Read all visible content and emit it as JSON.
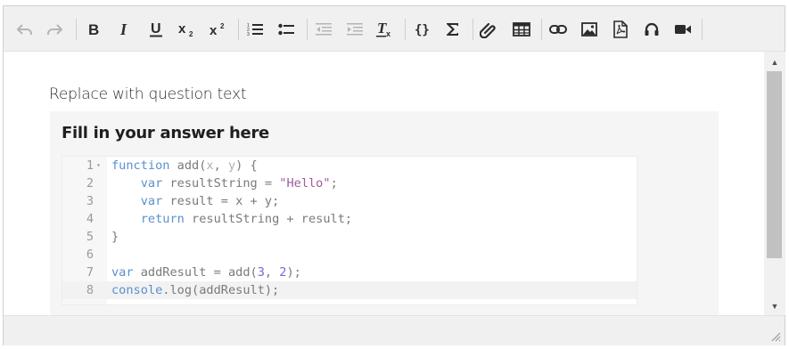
{
  "toolbar": {
    "buttons": [
      {
        "name": "undo-icon",
        "tooltip": "Undo",
        "enabled": false
      },
      {
        "name": "redo-icon",
        "tooltip": "Redo",
        "enabled": false
      },
      {
        "name": "bold-icon",
        "tooltip": "Bold",
        "enabled": true
      },
      {
        "name": "italic-icon",
        "tooltip": "Italic",
        "enabled": true
      },
      {
        "name": "underline-icon",
        "tooltip": "Underline",
        "enabled": true
      },
      {
        "name": "subscript-icon",
        "tooltip": "Subscript",
        "enabled": true
      },
      {
        "name": "superscript-icon",
        "tooltip": "Superscript",
        "enabled": true
      },
      {
        "name": "numbered-list-icon",
        "tooltip": "Numbered list",
        "enabled": true
      },
      {
        "name": "bulleted-list-icon",
        "tooltip": "Bulleted list",
        "enabled": true
      },
      {
        "name": "decrease-indent-icon",
        "tooltip": "Decrease indent",
        "enabled": false
      },
      {
        "name": "increase-indent-icon",
        "tooltip": "Increase indent",
        "enabled": false
      },
      {
        "name": "clear-formatting-icon",
        "tooltip": "Clear formatting",
        "enabled": true
      },
      {
        "name": "code-braces-icon",
        "tooltip": "Code",
        "enabled": true
      },
      {
        "name": "sigma-icon",
        "tooltip": "Math",
        "enabled": true
      },
      {
        "name": "paperclip-icon",
        "tooltip": "Attach file",
        "enabled": true
      },
      {
        "name": "table-icon",
        "tooltip": "Table",
        "enabled": true
      },
      {
        "name": "link-icon",
        "tooltip": "Link",
        "enabled": true
      },
      {
        "name": "image-icon",
        "tooltip": "Image",
        "enabled": true
      },
      {
        "name": "pdf-icon",
        "tooltip": "PDF",
        "enabled": true
      },
      {
        "name": "headphones-icon",
        "tooltip": "Audio",
        "enabled": true
      },
      {
        "name": "video-camera-icon",
        "tooltip": "Video",
        "enabled": true
      }
    ]
  },
  "content": {
    "question_text": "Replace with question text",
    "answer_title": "Fill in your answer here"
  },
  "code": {
    "language": "javascript",
    "active_line": 8,
    "lines": [
      {
        "n": "1",
        "text": "function add(x, y) {"
      },
      {
        "n": "2",
        "text": "    var resultString = \"Hello\";"
      },
      {
        "n": "3",
        "text": "    var result = x + y;"
      },
      {
        "n": "4",
        "text": "    return resultString + result;"
      },
      {
        "n": "5",
        "text": "}"
      },
      {
        "n": "6",
        "text": ""
      },
      {
        "n": "7",
        "text": "var addResult = add(3, 2);"
      },
      {
        "n": "8",
        "text": "console.log(addResult);"
      }
    ]
  },
  "colors": {
    "toolbar_bg": "#f0f0f0",
    "keyword": "#5a8fd0",
    "string": "#a05a9a",
    "number": "#6b6bd6",
    "scroll_thumb": "#c1c1c1"
  }
}
